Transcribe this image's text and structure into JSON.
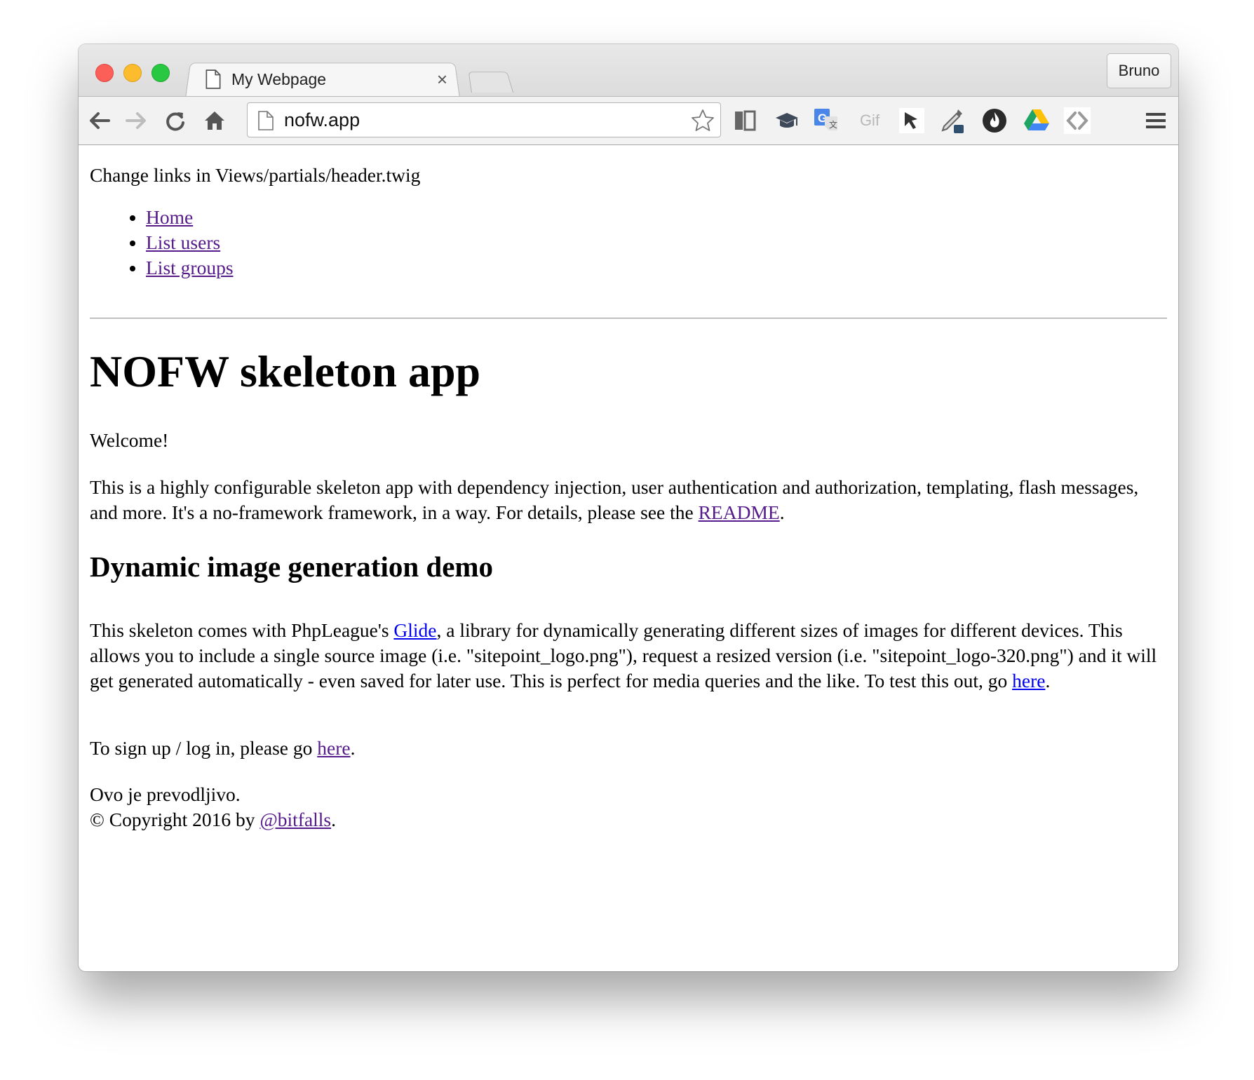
{
  "browser": {
    "tab_title": "My Webpage",
    "tab_close": "×",
    "profile_name": "Bruno",
    "address": "nofw.app",
    "extensions": [
      "reader-icon",
      "mortarboard-icon",
      "google-translate-icon",
      "gif-icon",
      "cursor-icon",
      "eyedropper-icon",
      "flame-icon",
      "google-drive-icon",
      "code-icon"
    ],
    "gif_label": "Gif"
  },
  "header": {
    "intro": "Change links in Views/partials/header.twig",
    "nav": [
      "Home",
      "List users",
      "List groups"
    ]
  },
  "main": {
    "title": "NOFW skeleton app",
    "welcome": "Welcome!",
    "para1_text": "This is a highly configurable skeleton app with dependency injection, user authentication and authorization, templating, flash messages, and more. It's a no-framework framework, in a way. For details, please see the ",
    "para1_link": "README",
    "para1_end": ".",
    "subtitle": "Dynamic image generation demo",
    "para2_start": "This skeleton comes with PhpLeague's ",
    "para2_link1": "Glide",
    "para2_mid": ", a library for dynamically generating different sizes of images for different devices. This allows you to include a single source image (i.e. \"sitepoint_logo.png\"), request a resized version (i.e. \"sitepoint_logo-320.png\") and it will get generated automatically - even saved for later use. This is perfect for media queries and the like. To test this out, go ",
    "para2_link2": "here",
    "para2_end": ".",
    "para3_start": "To sign up / log in, please go ",
    "para3_link": "here",
    "para3_end": "."
  },
  "footer": {
    "translatable": "Ovo je prevodljivo.",
    "copyright_start": "© Copyright 2016 by ",
    "copyright_link": "@bitfalls",
    "copyright_end": "."
  }
}
